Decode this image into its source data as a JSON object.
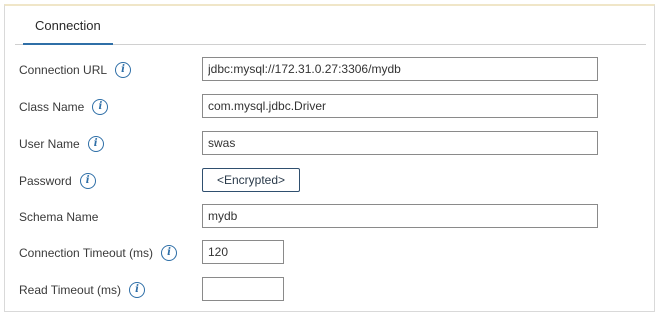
{
  "tabs": [
    {
      "label": "Connection",
      "active": true
    }
  ],
  "fields": {
    "connection_url": {
      "label": "Connection URL",
      "value": "jdbc:mysql://172.31.0.27:3306/mydb"
    },
    "class_name": {
      "label": "Class Name",
      "value": "com.mysql.jdbc.Driver"
    },
    "user_name": {
      "label": "User Name",
      "value": "swas"
    },
    "password": {
      "label": "Password",
      "button_label": "<Encrypted>"
    },
    "schema_name": {
      "label": "Schema Name",
      "value": "mydb"
    },
    "connection_timeout": {
      "label": "Connection Timeout (ms)",
      "value": "120"
    },
    "read_timeout": {
      "label": "Read Timeout (ms)",
      "value": ""
    }
  },
  "icons": {
    "info": "info-icon"
  },
  "colors": {
    "accent": "#2f6fa7",
    "border": "#d9d9d9",
    "top_border": "#f0e6c8"
  }
}
